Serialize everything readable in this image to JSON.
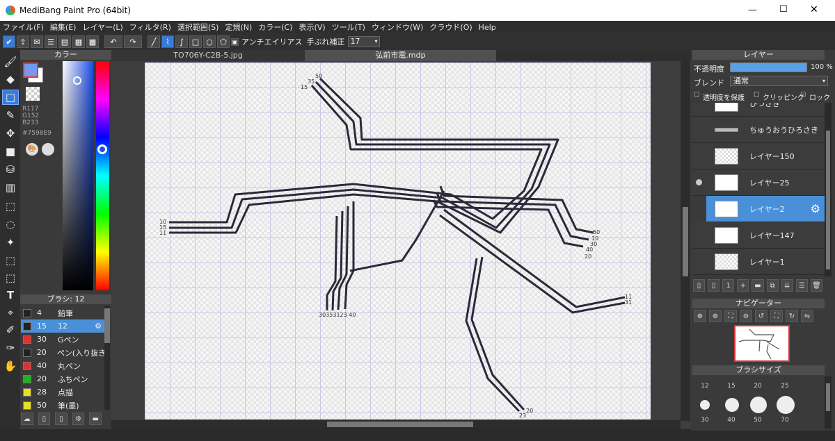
{
  "window": {
    "title": "MediBang Paint Pro (64bit)",
    "min": "—",
    "max": "☐",
    "close": "✕"
  },
  "menu": [
    "ファイル(F)",
    "編集(E)",
    "レイヤー(L)",
    "フィルタ(R)",
    "選択範囲(S)",
    "定規(N)",
    "カラー(C)",
    "表示(V)",
    "ツール(T)",
    "ウィンドウ(W)",
    "クラウド(O)",
    "Help"
  ],
  "toolbar": {
    "antialias": "アンチエイリアス",
    "stabilizer_label": "手ぶれ補正",
    "stabilizer_value": "17"
  },
  "tabs": [
    "TO706Y-C2B-5.jpg",
    "弘前市電.mdp"
  ],
  "color_panel": {
    "title": "カラー",
    "r": "R117",
    "g": "G152",
    "b": "B233",
    "hex": "#7598E9",
    "fg": "#7598E9"
  },
  "brush_panel": {
    "title": "ブラシ: 12",
    "items": [
      {
        "size": "4",
        "name": "鉛筆",
        "color": "#222222"
      },
      {
        "size": "15",
        "name": "12",
        "color": "#222222",
        "selected": true
      },
      {
        "size": "30",
        "name": "Gペン",
        "color": "#e03030"
      },
      {
        "size": "20",
        "name": "ペン(入り抜き",
        "color": "#222222"
      },
      {
        "size": "40",
        "name": "丸ペン",
        "color": "#e03030"
      },
      {
        "size": "20",
        "name": "ふちペン",
        "color": "#20b020"
      },
      {
        "size": "28",
        "name": "点描",
        "color": "#e8e020"
      },
      {
        "size": "50",
        "name": "筆(墨)",
        "color": "#e8e020"
      }
    ]
  },
  "layer_panel": {
    "title": "レイヤー",
    "opacity_label": "不透明度",
    "opacity_value": "100 %",
    "opacity": 1.0,
    "blend_label": "ブレンド",
    "blend_value": "通常",
    "protect": "透明度を保護",
    "clipping": "クリッピング",
    "lock": "ロック",
    "layers": [
      {
        "name": "ひつさき"
      },
      {
        "name": "ちゅうおうひろさき"
      },
      {
        "name": "レイヤー150"
      },
      {
        "name": "レイヤー25"
      },
      {
        "name": "レイヤー2",
        "selected": true
      },
      {
        "name": "レイヤー147"
      },
      {
        "name": "レイヤー1"
      }
    ]
  },
  "navigator": {
    "title": "ナビゲーター"
  },
  "brush_size": {
    "title": "ブラシサイズ",
    "sizes_top": [
      "12",
      "15",
      "20",
      "25"
    ],
    "sizes_bottom": [
      "30",
      "40",
      "50",
      "70"
    ]
  },
  "canvas_labels": {
    "top": [
      "50",
      "35",
      "15"
    ],
    "left": [
      "10",
      "15",
      "11"
    ],
    "right_mid": [
      "50",
      "10",
      "30",
      "40",
      "20"
    ],
    "right_low": [
      "11",
      "31"
    ],
    "bottom_group": "30353123 40",
    "bottom_end": [
      "20",
      "23"
    ]
  }
}
